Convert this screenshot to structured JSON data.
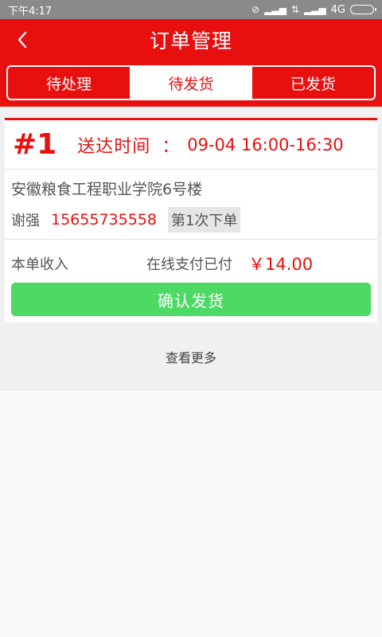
{
  "status_bar": {
    "time": "下午4:17",
    "network": "4G",
    "icons": [
      "mute-icon",
      "signal-icon",
      "data-arrows-icon",
      "signal-icon",
      "battery-icon"
    ]
  },
  "header": {
    "title": "订单管理",
    "back_icon": "back-arrow-icon"
  },
  "tabs": [
    {
      "label": "待处理",
      "active": false
    },
    {
      "label": "待发货",
      "active": true
    },
    {
      "label": "已发货",
      "active": false
    }
  ],
  "order": {
    "number": "#1",
    "delivery_label": "送达时间",
    "delivery_sep": "：",
    "delivery_time": "09-04 16:00-16:30",
    "address": "安徽粮食工程职业学院6号楼",
    "name": "谢强",
    "phone": "15655735558",
    "order_count": "第1次下单",
    "income_label": "本单收入",
    "payment_status": "在线支付已付",
    "amount": "￥14.00",
    "confirm_label": "确认发货"
  },
  "more_label": "查看更多",
  "colors": {
    "brand_red": "#e8100f",
    "confirm_green": "#4cd964",
    "status_gray": "#8a8a8a"
  }
}
